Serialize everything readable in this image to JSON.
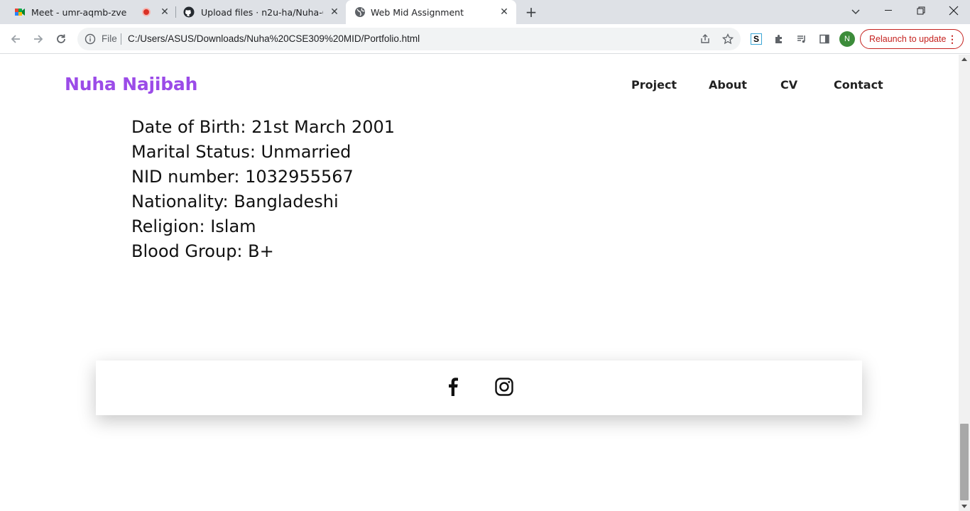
{
  "browser": {
    "tabs": [
      {
        "title": "Meet - umr-aqmb-zve",
        "icon": "google-meet-icon",
        "recording": true
      },
      {
        "title": "Upload files · n2u-ha/Nuha-CSE",
        "icon": "github-icon"
      },
      {
        "title": "Web Mid Assignment",
        "icon": "globe-icon",
        "active": true
      }
    ],
    "new_tab_label": "+",
    "address": {
      "scheme_label": "File",
      "url": "C:/Users/ASUS/Downloads/Nuha%20CSE309%20MID/Portfolio.html"
    },
    "avatar_initial": "N",
    "relaunch_label": "Relaunch to update"
  },
  "page": {
    "brand": "Nuha Najibah",
    "nav": [
      "Project",
      "About",
      "CV",
      "Contact"
    ],
    "personal_info": [
      "Date of Birth: 21st March 2001",
      "Marital Status: Unmarried",
      "NID number: 1032955567",
      "Nationality: Bangladeshi",
      "Religion: Islam",
      "Blood Group: B+"
    ],
    "footer_social": [
      "facebook-icon",
      "instagram-icon"
    ]
  },
  "colors": {
    "brand": "#9b4be8",
    "relaunch": "#c5221f",
    "tabstrip": "#dee1e6"
  }
}
